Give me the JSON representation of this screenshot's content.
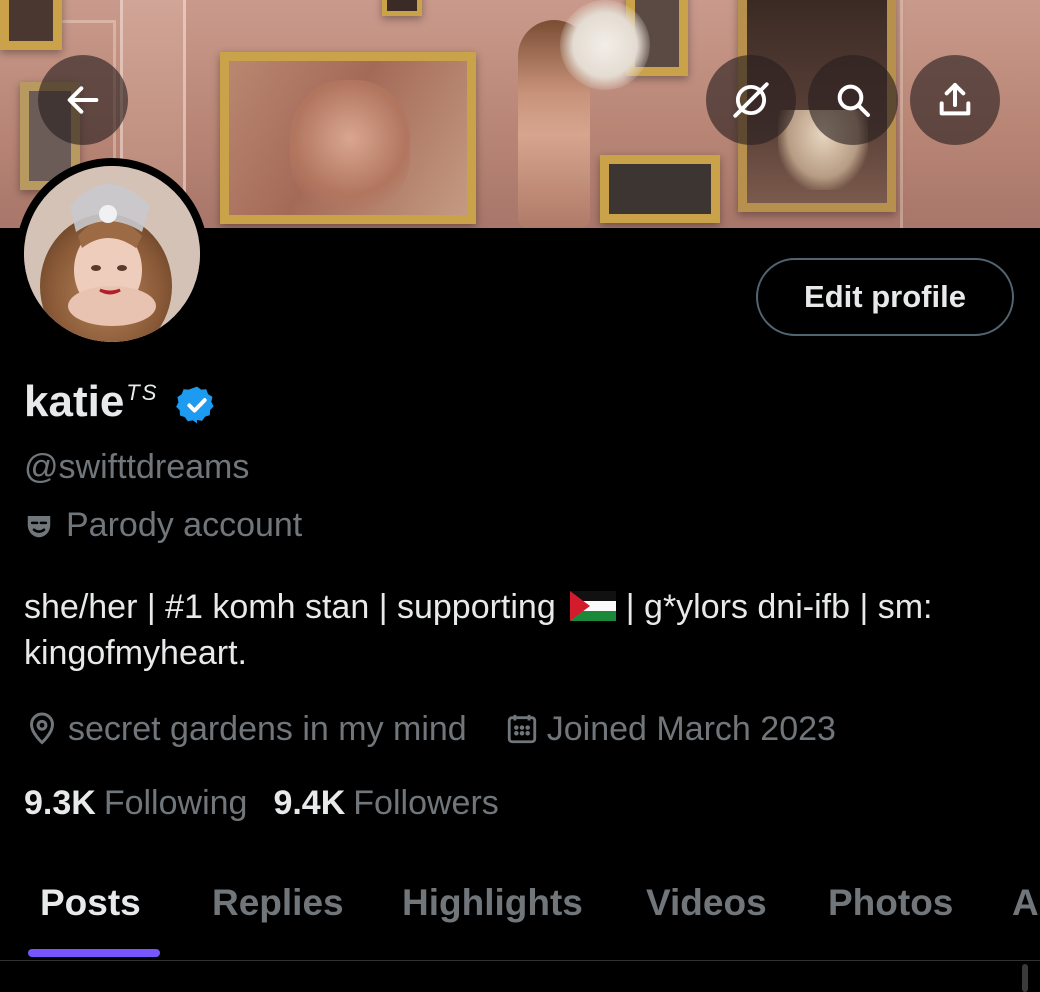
{
  "header": {
    "back_icon": "arrow-left-icon",
    "grok_icon": "grok-icon",
    "search_icon": "search-icon",
    "share_icon": "share-upload-icon"
  },
  "profile": {
    "display_name": "katie",
    "name_suffix": "TS",
    "verified": true,
    "handle": "@swifttdreams",
    "parody_label": "Parody account",
    "bio_part1": "she/her | #1 komh stan | supporting",
    "bio_part2": "| g*ylors dni-ifb | sm: kingofmyheart.",
    "location": "secret gardens in my mind",
    "joined": "Joined March 2023",
    "following_count": "9.3K",
    "following_label": "Following",
    "followers_count": "9.4K",
    "followers_label": "Followers",
    "edit_label": "Edit profile"
  },
  "tabs": [
    {
      "label": "Posts",
      "active": true
    },
    {
      "label": "Replies",
      "active": false
    },
    {
      "label": "Highlights",
      "active": false
    },
    {
      "label": "Videos",
      "active": false
    },
    {
      "label": "Photos",
      "active": false
    },
    {
      "label": "A",
      "active": false
    }
  ],
  "colors": {
    "accent": "#7856ff",
    "verified": "#1d9bf0",
    "muted": "#71767b",
    "text": "#e7e9ea"
  }
}
